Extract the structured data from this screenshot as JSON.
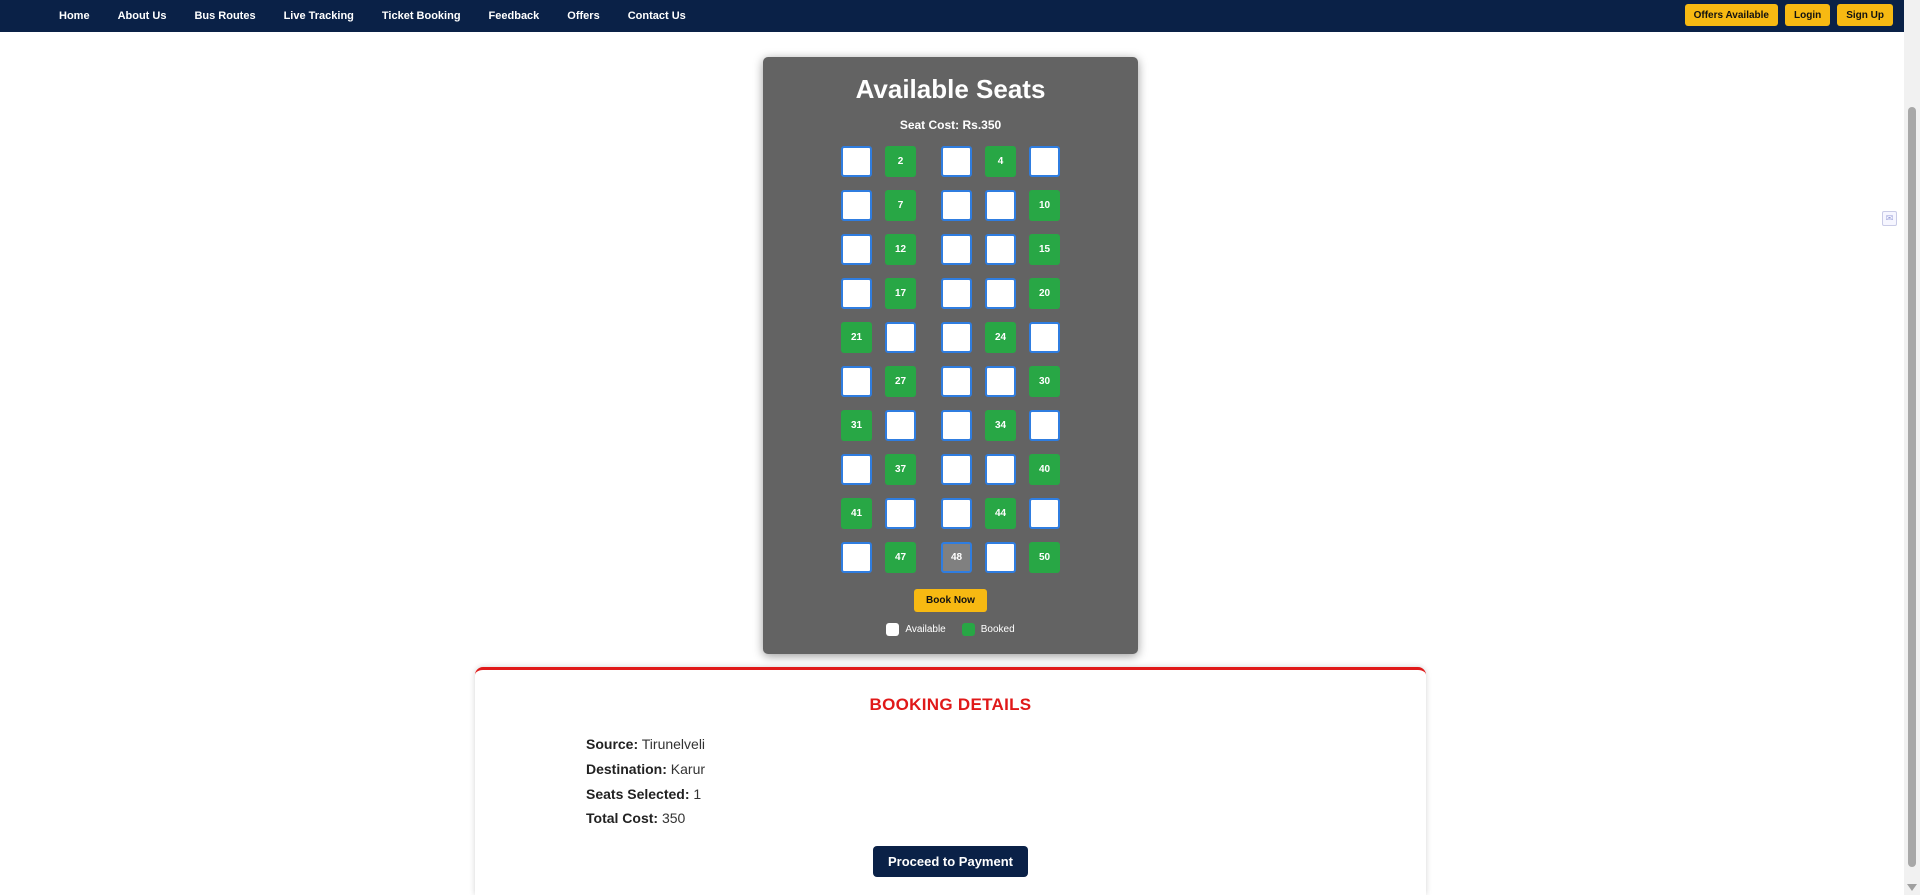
{
  "nav": {
    "links": [
      "Home",
      "About Us",
      "Bus Routes",
      "Live Tracking",
      "Ticket Booking",
      "Feedback",
      "Offers",
      "Contact Us"
    ],
    "offers_label": "Offers Available",
    "login_label": "Login",
    "signup_label": "Sign Up"
  },
  "seat_panel": {
    "title": "Available Seats",
    "cost_label": "Seat Cost: Rs.350",
    "book_label": "Book Now",
    "seats": [
      {
        "label": "",
        "status": "available"
      },
      {
        "label": "2",
        "status": "booked"
      },
      {
        "label": "",
        "status": "available"
      },
      {
        "label": "4",
        "status": "booked"
      },
      {
        "label": "",
        "status": "available"
      },
      {
        "label": "",
        "status": "available"
      },
      {
        "label": "7",
        "status": "booked"
      },
      {
        "label": "",
        "status": "available"
      },
      {
        "label": "",
        "status": "available"
      },
      {
        "label": "10",
        "status": "booked"
      },
      {
        "label": "",
        "status": "available"
      },
      {
        "label": "12",
        "status": "booked"
      },
      {
        "label": "",
        "status": "available"
      },
      {
        "label": "",
        "status": "available"
      },
      {
        "label": "15",
        "status": "booked"
      },
      {
        "label": "",
        "status": "available"
      },
      {
        "label": "17",
        "status": "booked"
      },
      {
        "label": "",
        "status": "available"
      },
      {
        "label": "",
        "status": "available"
      },
      {
        "label": "20",
        "status": "booked"
      },
      {
        "label": "21",
        "status": "booked"
      },
      {
        "label": "",
        "status": "available"
      },
      {
        "label": "",
        "status": "available"
      },
      {
        "label": "24",
        "status": "booked"
      },
      {
        "label": "",
        "status": "available"
      },
      {
        "label": "",
        "status": "available"
      },
      {
        "label": "27",
        "status": "booked"
      },
      {
        "label": "",
        "status": "available"
      },
      {
        "label": "",
        "status": "available"
      },
      {
        "label": "30",
        "status": "booked"
      },
      {
        "label": "31",
        "status": "booked"
      },
      {
        "label": "",
        "status": "available"
      },
      {
        "label": "",
        "status": "available"
      },
      {
        "label": "34",
        "status": "booked"
      },
      {
        "label": "",
        "status": "available"
      },
      {
        "label": "",
        "status": "available"
      },
      {
        "label": "37",
        "status": "booked"
      },
      {
        "label": "",
        "status": "available"
      },
      {
        "label": "",
        "status": "available"
      },
      {
        "label": "40",
        "status": "booked"
      },
      {
        "label": "41",
        "status": "booked"
      },
      {
        "label": "",
        "status": "available"
      },
      {
        "label": "",
        "status": "available"
      },
      {
        "label": "44",
        "status": "booked"
      },
      {
        "label": "",
        "status": "available"
      },
      {
        "label": "",
        "status": "available"
      },
      {
        "label": "47",
        "status": "booked"
      },
      {
        "label": "48",
        "status": "selected"
      },
      {
        "label": "",
        "status": "available"
      },
      {
        "label": "50",
        "status": "booked"
      }
    ],
    "legend": {
      "available": "Available",
      "booked": "Booked"
    }
  },
  "booking": {
    "title": "BOOKING DETAILS",
    "source_label": "Source:",
    "source": "Tirunelveli",
    "destination_label": "Destination:",
    "destination": "Karur",
    "seats_label": "Seats Selected:",
    "seats": "1",
    "cost_label": "Total Cost:",
    "cost": "350",
    "pay_label": "Proceed to Payment"
  },
  "colors": {
    "nav": "#0a2147",
    "accent": "#f7b912",
    "booked": "#28a745",
    "panel": "#636363",
    "details_title": "#e01919"
  }
}
